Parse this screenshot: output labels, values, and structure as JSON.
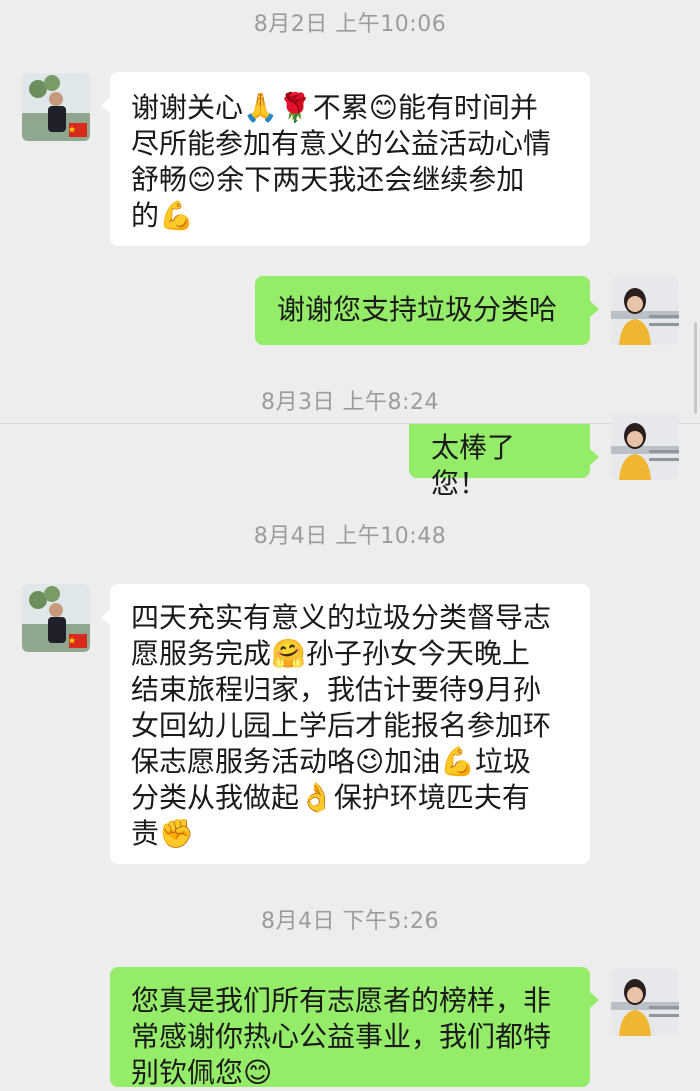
{
  "chat": {
    "timestamps": [
      "8月2日 上午10:06",
      "8月3日 上午8:24",
      "8月4日 上午10:48",
      "8月4日 下午5:26"
    ],
    "messages": [
      {
        "sender": "left",
        "lines": [
          "谢谢关心🙏🌹不累😊能有时间并",
          "尽所能参加有意义的公益活动心情",
          "舒畅😊余下两天我还会继续参加",
          "的💪"
        ]
      },
      {
        "sender": "right",
        "lines": [
          "谢谢您支持垃圾分类哈"
        ]
      },
      {
        "sender": "right",
        "lines": [
          "太棒了您！"
        ]
      },
      {
        "sender": "left",
        "lines": [
          "四天充实有意义的垃圾分类督导志",
          "愿服务完成🤗孙子孙女今天晚上",
          "结束旅程归家，我估计要待9月孙",
          "女回幼儿园上学后才能报名参加环",
          "保志愿服务活动咯😉加油💪垃圾",
          "分类从我做起👌保护环境匹夫有",
          "责✊"
        ]
      },
      {
        "sender": "right",
        "lines": [
          "您真是我们所有志愿者的榜样，非",
          "常感谢你热心公益事业，我们都特",
          "别钦佩您😊"
        ]
      }
    ]
  },
  "colors": {
    "background": "#ededed",
    "bubble_self": "#95ec69",
    "bubble_other": "#ffffff",
    "timestamp_text": "#9c9c9c"
  }
}
